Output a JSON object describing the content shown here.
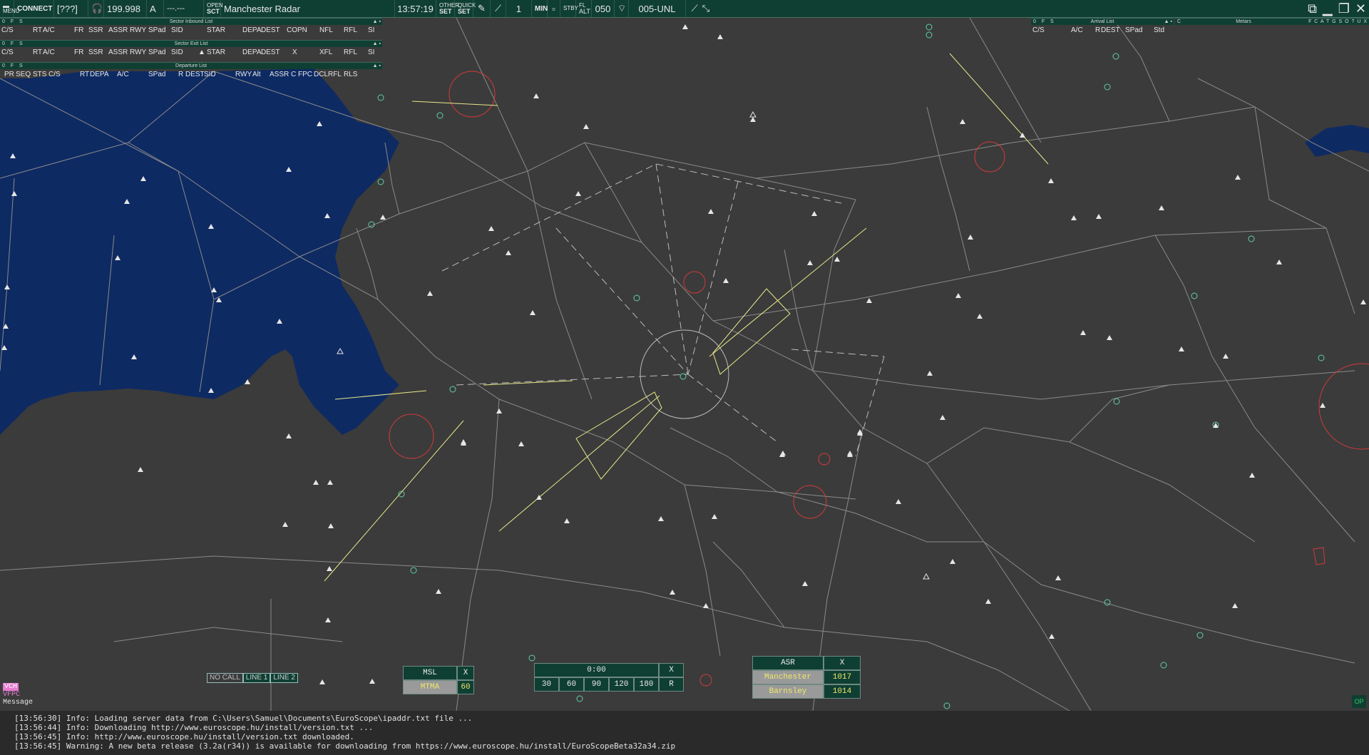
{
  "toolbar": {
    "menu_label": "MENU",
    "connect_label": "CONNECT",
    "connect_status": "[???]",
    "frequency": "199.998",
    "atis_letter": "A",
    "secondary_freq": "---.---",
    "open_sct_top": "OPEN",
    "open_sct_bottom": "SCT",
    "position_name": "Manchester Radar",
    "clock": "13:57:19",
    "other_set_top": "OTHER",
    "other_set_bottom": "SET",
    "quick_set_top": "QUICK",
    "quick_set_bottom": "SET",
    "counter": "1",
    "min_label": "MIN",
    "stby_top": "STBY",
    "stby_bottom": "",
    "fl_alt_top": "FL",
    "fl_alt_bottom": "ALT",
    "transition_level": "050",
    "level_filter": "005-UNL"
  },
  "lists": {
    "sector_inbound": {
      "title": "Sector Inbound List",
      "flags": "0 F S",
      "columns": [
        "C/S",
        "RT",
        "A/C",
        "FR",
        "SSR",
        "ASSR",
        "RWY",
        "SPad",
        "SID",
        "STAR",
        "DEPA",
        "DEST",
        "COPN",
        "NFL",
        "RFL",
        "SI"
      ]
    },
    "sector_exit": {
      "title": "Sector Exit List",
      "flags": "0 F S",
      "columns": [
        "C/S",
        "RT",
        "A/C",
        "FR",
        "SSR",
        "ASSR",
        "RWY",
        "SPad",
        "SID",
        "STAR",
        "DEPA",
        "DEST",
        "X",
        "XFL",
        "RFL",
        "SI"
      ]
    },
    "departure": {
      "title": "Departure List",
      "flags": "0 F S",
      "columns": [
        "PR",
        "SEQ",
        "STS",
        "C/S",
        "RT",
        "DEPA",
        "A/C",
        "SPad",
        "R",
        "DEST",
        "SID",
        "RWY",
        "Alt",
        "ASSR",
        "C",
        "FPC",
        "DCL",
        "RFL",
        "RLS"
      ]
    },
    "arrival": {
      "title": "Arrival List",
      "flags": "0 F S",
      "columns": [
        "C/S",
        "A/C",
        "R",
        "DEST",
        "SPad",
        "Std"
      ]
    },
    "metars": {
      "title": "Metars",
      "flags": "C",
      "buttons": "F C A T G S O ? U X"
    }
  },
  "msl": {
    "header": "MSL",
    "close": "X",
    "name": "MTMA",
    "value": "60"
  },
  "timer": {
    "display": "0:00",
    "close": "X",
    "presets": [
      "30",
      "60",
      "90",
      "120",
      "180"
    ],
    "reset": "R"
  },
  "asr": {
    "header": "ASR",
    "close": "X",
    "rows": [
      {
        "name": "Manchester",
        "value": "1017"
      },
      {
        "name": "Barnsley",
        "value": "1014"
      }
    ]
  },
  "calls": {
    "no_call": "NO CALL",
    "line1": "LINE 1",
    "line2": "LINE 2"
  },
  "chat": {
    "vch": "VCH",
    "vfpc": "VFPC",
    "message": "Message",
    "log": [
      "[13:56:30] Info: Loading server data from C:\\Users\\Samuel\\Documents\\EuroScope\\ipaddr.txt file ...",
      "[13:56:44] Info: Downloading http://www.euroscope.hu/install/version.txt ...",
      "[13:56:45] Info: http://www.euroscope.hu/install/version.txt downloaded.",
      "[13:56:45] Warning: A new beta release (3.2a(r34)) is available for downloading from https://www.euroscope.hu/install/EuroScopeBeta32a34.zip"
    ]
  },
  "status": {
    "op": "OP"
  },
  "colors": {
    "toolbar_bg": "#0f3f32",
    "map_bg": "#3b3b3b",
    "sea": "#0e2a63",
    "runway": "#e8e88a",
    "restricted": "#d23a3a",
    "vor": "#5fd0a5"
  }
}
